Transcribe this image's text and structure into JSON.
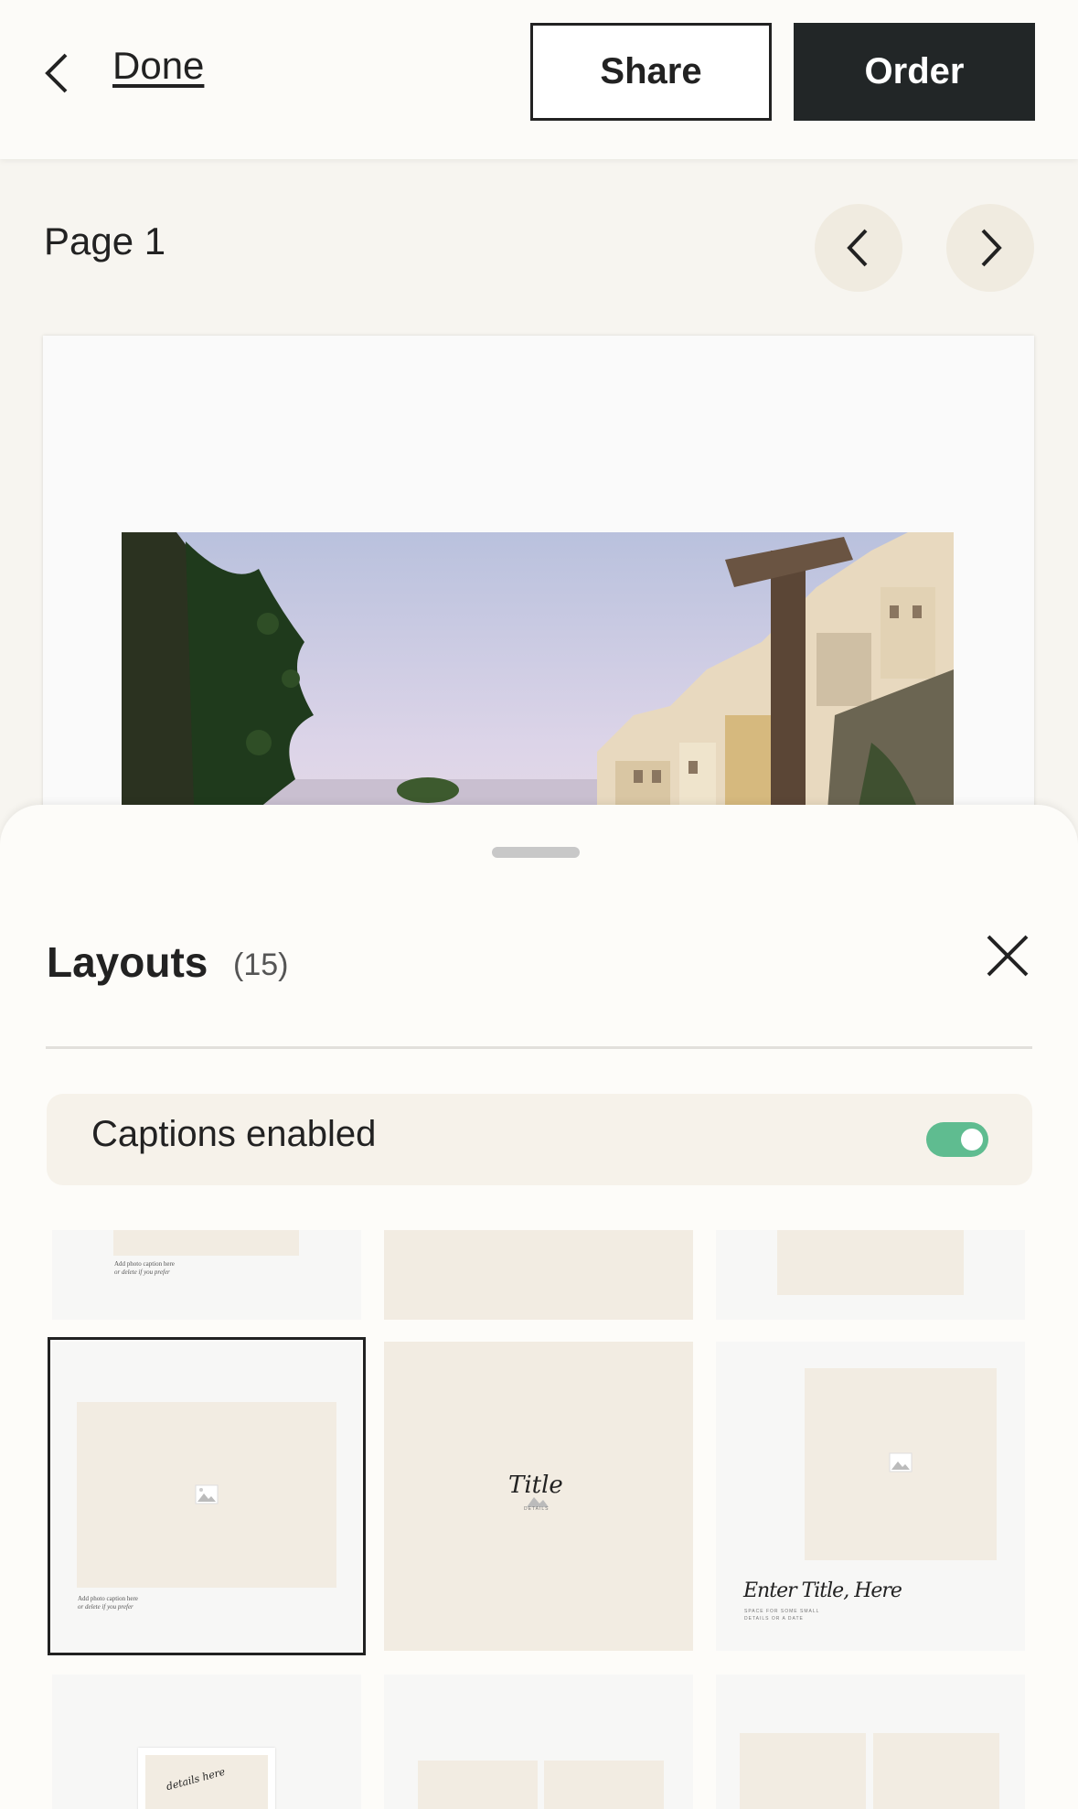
{
  "header": {
    "done_label": "Done",
    "share_label": "Share",
    "order_label": "Order"
  },
  "page_nav": {
    "label": "Page 1"
  },
  "sheet": {
    "title": "Layouts",
    "count": "(15)",
    "captions_label": "Captions enabled",
    "captions_enabled": true
  },
  "thumbnails": {
    "caption_line1": "Add photo caption here",
    "caption_line2": "or delete if you prefer",
    "title_script": "Title",
    "title_details": "DETAILS",
    "enter_title": "Enter Title, Here",
    "space_line1": "SPACE FOR SOME SMALL",
    "space_line2": "DETAILS OR A DATE",
    "details_here": "details here"
  },
  "colors": {
    "accent_toggle": "#5fbc90",
    "order_button": "#222627",
    "placeholder_beige": "#f2ece2"
  }
}
